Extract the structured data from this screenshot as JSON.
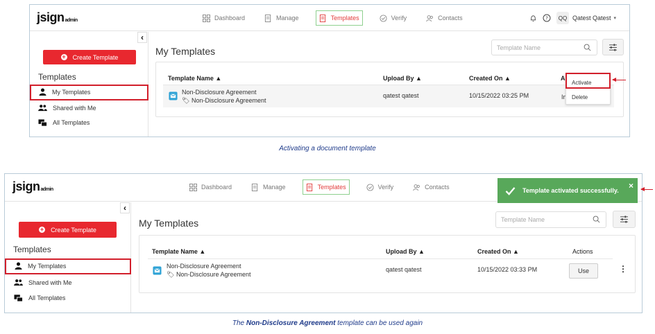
{
  "app": {
    "logo_main": "jsign",
    "logo_sub": "admin"
  },
  "nav": {
    "dashboard": "Dashboard",
    "manage": "Manage",
    "templates": "Templates",
    "verify": "Verify",
    "contacts": "Contacts"
  },
  "user": {
    "initials": "QQ",
    "name": "Qatest Qatest"
  },
  "sidebar": {
    "create_label": "Create Template",
    "heading": "Templates",
    "items": [
      "My Templates",
      "Shared with Me",
      "All Templates"
    ]
  },
  "main": {
    "title": "My Templates",
    "search_placeholder": "Template Name"
  },
  "table": {
    "col_name": "Template Name",
    "col_upload": "Upload By",
    "col_created": "Created On",
    "col_actions": "Actions",
    "col_actions_partial": "A",
    "status_partial": "In"
  },
  "shot1": {
    "row": {
      "name": "Non-Disclosure Agreement",
      "tag": "Non-Disclosure Agreement",
      "upload_by": "qatest qatest",
      "created_on": "10/15/2022 03:25 PM"
    },
    "menu": {
      "activate": "Activate",
      "delete": "Delete"
    },
    "caption": "Activating a document template"
  },
  "shot2": {
    "row": {
      "name": "Non-Disclosure Agreement",
      "tag": "Non-Disclosure Agreement",
      "upload_by": "qatest qatest",
      "created_on": "10/15/2022 03:33 PM",
      "use_label": "Use",
      "kebab": "⋮"
    },
    "toast": {
      "message": "Template activated successfully.",
      "close": "×"
    },
    "caption_pre": "The ",
    "caption_bold": "Non-Disclosure Agreement",
    "caption_post": " template can be used again"
  },
  "colors": {
    "accent": "#e8282f",
    "highlight": "#d21f2b",
    "toast": "#58a85a",
    "caption": "#1f3b8a"
  }
}
